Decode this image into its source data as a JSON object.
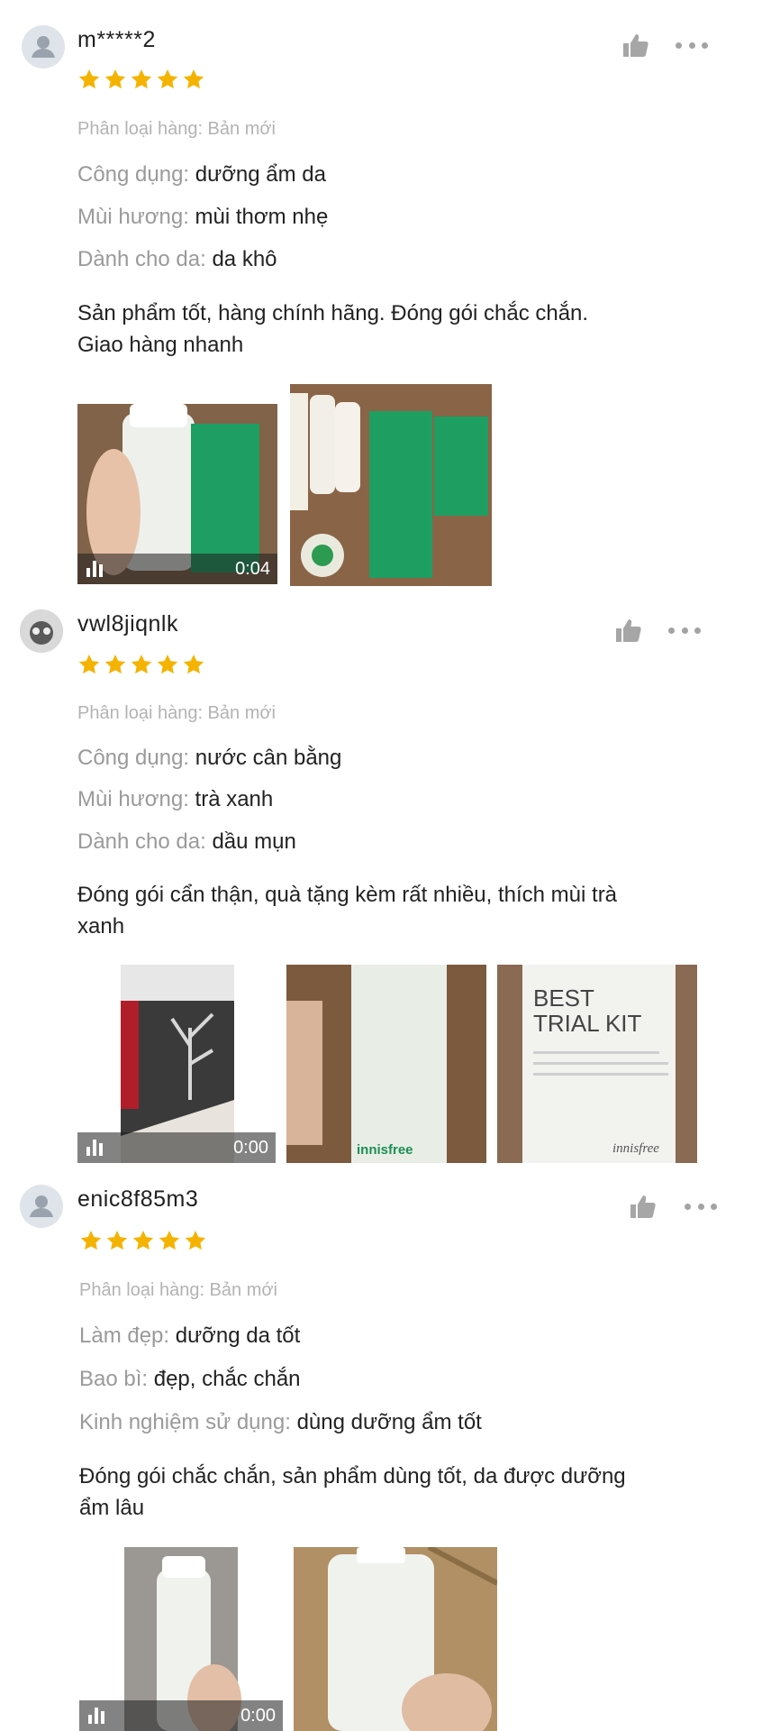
{
  "colors": {
    "star": "#f5b301",
    "key": "#9a9a9a",
    "value": "#222222",
    "variant": "#b3b3b3"
  },
  "icons": {
    "like": "thumbs-up-icon",
    "more": "more-dots-icon",
    "star": "star-icon",
    "video": "video-bars-icon"
  },
  "reviews": [
    {
      "username": "m*****2",
      "rating": 5,
      "variant": "Phân loại hàng: Bản mới",
      "attributes": [
        {
          "key": "Công dụng:",
          "value": "dưỡng ẩm da"
        },
        {
          "key": "Mùi hương:",
          "value": "mùi thơm nhẹ"
        },
        {
          "key": "Dành cho da:",
          "value": "da khô"
        }
      ],
      "comment_lines": [
        "Sản phẩm tốt, hàng chính hãng. Đóng gói chắc chắn.",
        "Giao hàng nhanh"
      ],
      "media": [
        {
          "type": "video",
          "duration": "0:04"
        },
        {
          "type": "photo"
        }
      ]
    },
    {
      "username": "vwl8jiqnlk",
      "rating": 5,
      "variant": "Phân loại hàng: Bản mới",
      "attributes": [
        {
          "key": "Công dụng:",
          "value": "nước cân bằng"
        },
        {
          "key": "Mùi hương:",
          "value": "trà xanh"
        },
        {
          "key": "Dành cho da:",
          "value": "dầu mụn"
        }
      ],
      "comment_lines": [
        "Đóng gói cẩn thận, quà tặng kèm rất nhiều, thích mùi trà",
        "xanh"
      ],
      "media": [
        {
          "type": "video",
          "duration": "0:00"
        },
        {
          "type": "photo",
          "label": "innisfree"
        },
        {
          "type": "photo",
          "label_lines": [
            "BEST",
            "TRIAL KIT"
          ],
          "brand": "innisfree"
        }
      ]
    },
    {
      "username": "enic8f85m3",
      "rating": 5,
      "variant": "Phân loại hàng: Bản mới",
      "attributes": [
        {
          "key": "Làm đẹp:",
          "value": "dưỡng da tốt"
        },
        {
          "key": "Bao bì:",
          "value": "đẹp, chắc chắn"
        },
        {
          "key": "Kinh nghiệm sử dụng:",
          "value": "dùng dưỡng ẩm tốt"
        }
      ],
      "comment_lines": [
        "Đóng gói chắc chắn, sản phẩm dùng tốt, da được dưỡng",
        "ẩm lâu"
      ],
      "media": [
        {
          "type": "video",
          "duration": "0:00"
        },
        {
          "type": "photo"
        }
      ]
    }
  ]
}
